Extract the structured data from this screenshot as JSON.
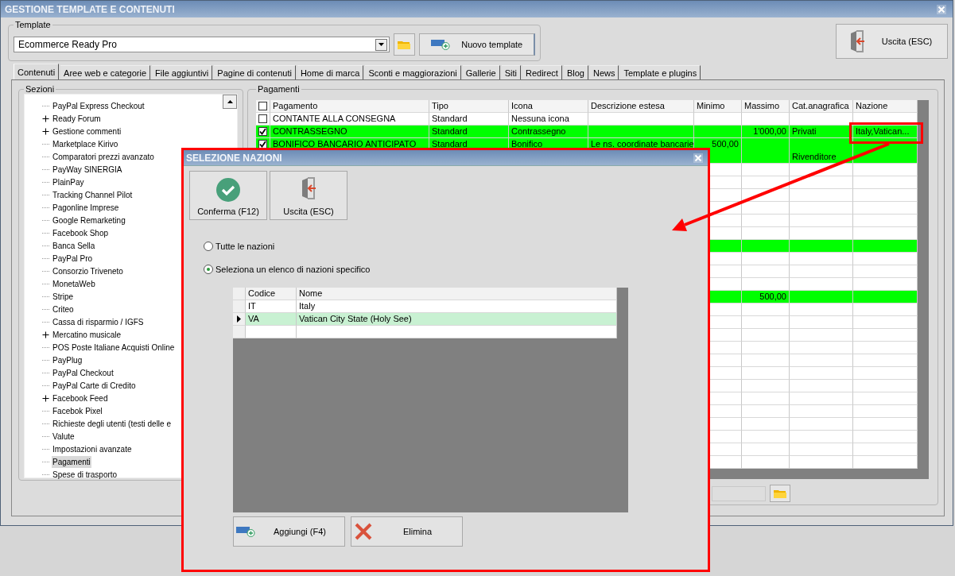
{
  "window": {
    "title": "GESTIONE TEMPLATE E CONTENUTI"
  },
  "template": {
    "label": "Template",
    "value": "Ecommerce Ready Pro",
    "new_button": "Nuovo template"
  },
  "exit_button": "Uscita (ESC)",
  "tabs": [
    {
      "label": "Contenuti",
      "selected": true
    },
    {
      "label": "Aree web e categorie",
      "selected": false
    },
    {
      "label": "File aggiuntivi",
      "selected": false
    },
    {
      "label": "Pagine di contenuti",
      "selected": false
    },
    {
      "label": "Home di marca",
      "selected": false
    },
    {
      "label": "Sconti e maggiorazioni",
      "selected": false
    },
    {
      "label": "Gallerie",
      "selected": false
    },
    {
      "label": "Siti",
      "selected": false
    },
    {
      "label": "Redirect",
      "selected": false
    },
    {
      "label": "Blog",
      "selected": false
    },
    {
      "label": "News",
      "selected": false
    },
    {
      "label": "Template e plugins",
      "selected": false
    }
  ],
  "sections": {
    "label": "Sezioni",
    "items": [
      {
        "label": "PayPal Express Checkout",
        "has_children": false,
        "selected": false
      },
      {
        "label": "Ready Forum",
        "has_children": true,
        "selected": false
      },
      {
        "label": "Gestione commenti",
        "has_children": true,
        "selected": false
      },
      {
        "label": "Marketplace Kirivo",
        "has_children": false,
        "selected": false
      },
      {
        "label": "Comparatori prezzi avanzato",
        "has_children": false,
        "selected": false
      },
      {
        "label": "PayWay SINERGIA",
        "has_children": false,
        "selected": false
      },
      {
        "label": "PlainPay",
        "has_children": false,
        "selected": false
      },
      {
        "label": "Tracking Channel Pilot",
        "has_children": false,
        "selected": false
      },
      {
        "label": "Pagonline Imprese",
        "has_children": false,
        "selected": false
      },
      {
        "label": "Google Remarketing",
        "has_children": false,
        "selected": false
      },
      {
        "label": "Facebook Shop",
        "has_children": false,
        "selected": false
      },
      {
        "label": "Banca Sella",
        "has_children": false,
        "selected": false
      },
      {
        "label": "PayPal Pro",
        "has_children": false,
        "selected": false
      },
      {
        "label": "Consorzio Triveneto",
        "has_children": false,
        "selected": false
      },
      {
        "label": "MonetaWeb",
        "has_children": false,
        "selected": false
      },
      {
        "label": "Stripe",
        "has_children": false,
        "selected": false
      },
      {
        "label": "Criteo",
        "has_children": false,
        "selected": false
      },
      {
        "label": "Cassa di risparmio / IGFS",
        "has_children": false,
        "selected": false
      },
      {
        "label": "Mercatino musicale",
        "has_children": true,
        "selected": false
      },
      {
        "label": "POS Poste Italiane Acquisti Online",
        "has_children": false,
        "selected": false
      },
      {
        "label": "PayPlug",
        "has_children": false,
        "selected": false
      },
      {
        "label": "PayPal Checkout",
        "has_children": false,
        "selected": false
      },
      {
        "label": "PayPal Carte di Credito",
        "has_children": false,
        "selected": false
      },
      {
        "label": "Facebook Feed",
        "has_children": true,
        "selected": false
      },
      {
        "label": "Facebok Pixel",
        "has_children": false,
        "selected": false
      },
      {
        "label": "Richieste degli utenti (testi delle e",
        "has_children": false,
        "selected": false
      },
      {
        "label": "Valute",
        "has_children": false,
        "selected": false
      },
      {
        "label": "Impostazioni avanzate",
        "has_children": false,
        "selected": false
      },
      {
        "label": "Pagamenti",
        "has_children": false,
        "selected": true
      },
      {
        "label": "Spese di trasporto",
        "has_children": false,
        "selected": false
      }
    ]
  },
  "payments": {
    "label": "Pagamenti",
    "select_all_checked": false,
    "columns": [
      "Pagamento",
      "Tipo",
      "Icona",
      "Descrizione estesa",
      "Minimo",
      "Massimo",
      "Cat.anagrafica",
      "Nazione"
    ],
    "rows": [
      {
        "checked": false,
        "highlighted": false,
        "tall": false,
        "cells": [
          "CONTANTE ALLA CONSEGNA",
          "Standard",
          "Nessuna icona",
          "",
          "",
          "",
          "",
          ""
        ]
      },
      {
        "checked": true,
        "highlighted": true,
        "tall": false,
        "cells": [
          "CONTRASSEGNO",
          "Standard",
          "Contrassegno",
          "",
          "",
          "1'000,00",
          "Privati",
          "Italy,Vatican..."
        ]
      },
      {
        "checked": true,
        "highlighted": true,
        "tall": true,
        "cells": [
          "BONIFICO BANCARIO ANTICIPATO",
          "Standard",
          "Bonifico",
          "Le ns. coordinate bancarie",
          "500,00",
          "",
          "Rivenditore",
          ""
        ]
      }
    ],
    "more_rows": [
      {
        "highlighted": false
      },
      {
        "highlighted": false
      },
      {
        "highlighted": false
      },
      {
        "highlighted": false
      },
      {
        "highlighted": false
      },
      {
        "highlighted": false
      },
      {
        "highlighted": true
      },
      {
        "highlighted": false
      },
      {
        "highlighted": false
      },
      {
        "highlighted": false
      },
      {
        "highlighted": true,
        "massimo": "500,00"
      },
      {
        "highlighted": false
      },
      {
        "highlighted": false
      },
      {
        "highlighted": false
      },
      {
        "highlighted": false
      },
      {
        "highlighted": false
      },
      {
        "highlighted": false
      },
      {
        "highlighted": false
      },
      {
        "highlighted": false
      },
      {
        "highlighted": false
      },
      {
        "highlighted": false
      },
      {
        "highlighted": false
      },
      {
        "highlighted": false
      },
      {
        "highlighted": false
      }
    ]
  },
  "dialog": {
    "title": "SELEZIONE NAZIONI",
    "buttons": [
      {
        "kind": "confirm",
        "label": "Conferma (F12)"
      },
      {
        "kind": "exit",
        "label": "Uscita (ESC)"
      }
    ],
    "options": [
      {
        "label": "Tutte le nazioni",
        "selected": false
      },
      {
        "label": "Seleziona un elenco di nazioni specifico",
        "selected": true
      }
    ],
    "nations": {
      "columns": [
        "Codice",
        "Nome"
      ],
      "rows": [
        {
          "code": "IT",
          "name": "Italy",
          "current": false
        },
        {
          "code": "VA",
          "name": "Vatican City State (Holy See)",
          "current": true
        }
      ]
    },
    "actions": [
      {
        "kind": "add",
        "label": "Aggiungi (F4)"
      },
      {
        "kind": "delete",
        "label": "Elimina"
      }
    ]
  }
}
